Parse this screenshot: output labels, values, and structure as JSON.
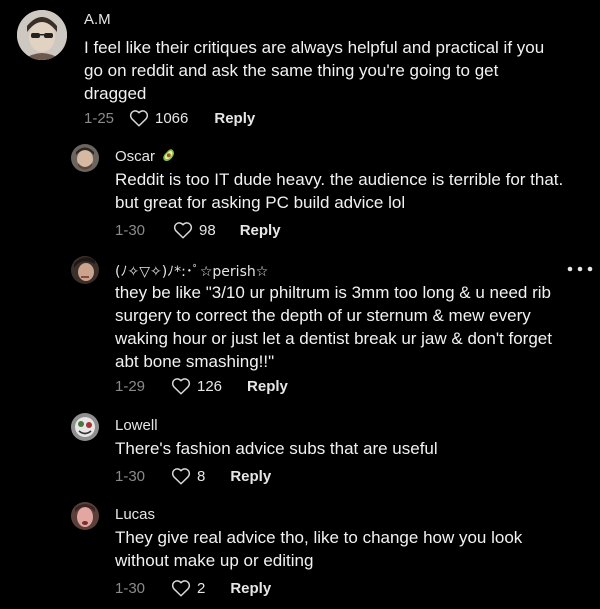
{
  "comments": [
    {
      "user": "A.M",
      "text": "I feel like their critiques are always helpful and practical if you go on reddit and ask the same thing you're going to get dragged",
      "date": "1-25",
      "likes": "1066",
      "reply_label": "Reply"
    },
    {
      "user": "Oscar",
      "user_badge": "avocado-icon",
      "text": "Reddit is too IT dude heavy. the audience is terrible for that. but great for asking PC build advice lol",
      "date": "1-30",
      "likes": "98",
      "reply_label": "Reply"
    },
    {
      "user": "(ﾉ✧▽✧)ﾉ*:･ﾟ☆perish☆",
      "text": "they be like \"3/10 ur philtrum is 3mm too long & u need rib surgery to correct the depth of ur sternum & mew every waking hour or just let a dentist break ur jaw & don't forget abt bone smashing!!\"",
      "date": "1-29",
      "likes": "126",
      "reply_label": "Reply"
    },
    {
      "user": "Lowell",
      "text": "There's fashion advice subs that are useful",
      "date": "1-30",
      "likes": "8",
      "reply_label": "Reply"
    },
    {
      "user": "Lucas",
      "text": "They give real advice tho, like to change how you look without make up or editing",
      "date": "1-30",
      "likes": "2",
      "reply_label": "Reply"
    }
  ],
  "icons": {
    "like": "heart-outline-icon",
    "more": "more-options-icon"
  },
  "colors": {
    "background": "#000000",
    "text": "#f2f2f2",
    "muted": "#8a8a8a"
  }
}
